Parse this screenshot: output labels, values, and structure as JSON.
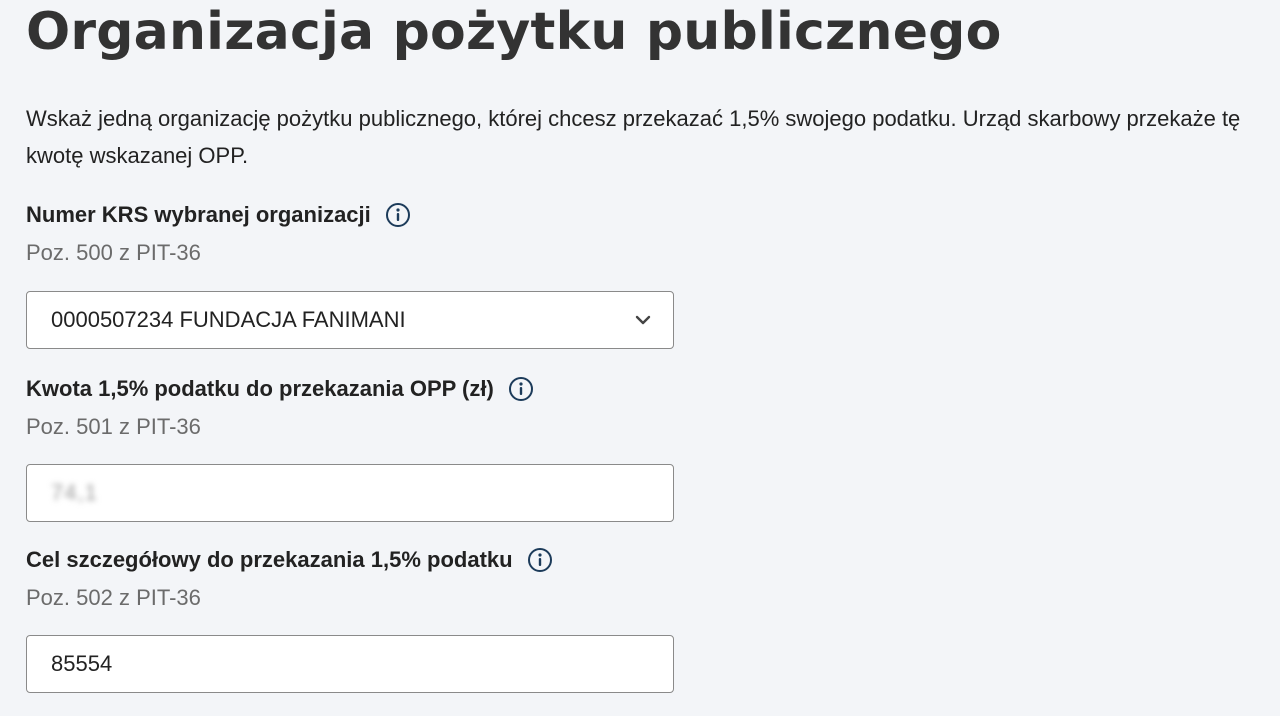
{
  "page": {
    "title": "Organizacja pożytku publicznego",
    "intro": "Wskaż jedną organizację pożytku publicznego, której chcesz przekazać 1,5% swojego podatku. Urząd skarbowy przekaże tę kwotę wskazanej OPP."
  },
  "fields": {
    "krs": {
      "label": "Numer KRS wybranej organizacji",
      "sub": "Poz. 500 z PIT-36",
      "selected": "0000507234 FUNDACJA FANIMANI",
      "icon": "info-icon"
    },
    "amount": {
      "label": "Kwota 1,5% podatku do przekazania OPP (zł)",
      "sub": "Poz. 501 z PIT-36",
      "value": "74,1",
      "icon": "info-icon"
    },
    "goal": {
      "label": "Cel szczegółowy do przekazania 1,5% podatku",
      "sub": "Poz. 502 z PIT-36",
      "value": "85554",
      "icon": "info-icon"
    }
  },
  "colors": {
    "background": "#f3f5f8",
    "icon": "#1c3b5a",
    "border": "#8a8a8a"
  }
}
